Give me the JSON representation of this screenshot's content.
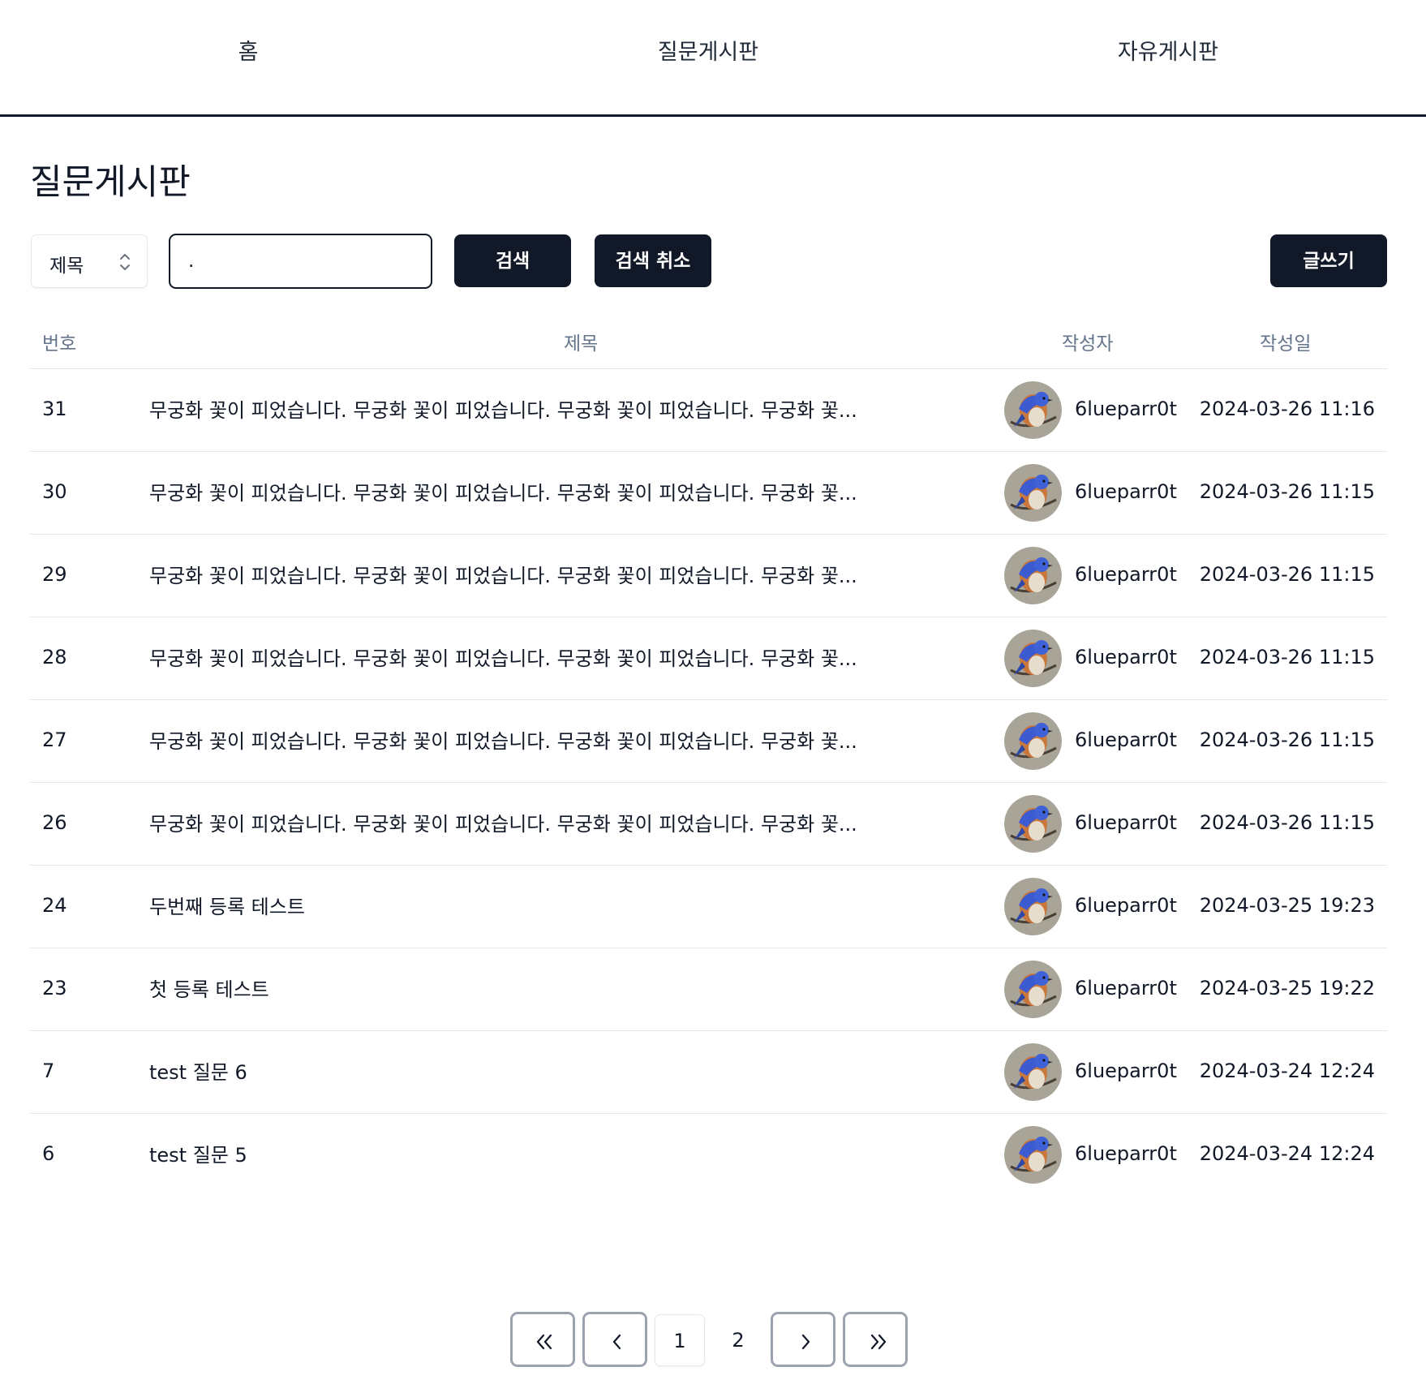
{
  "nav": {
    "home": "홈",
    "qna_board": "질문게시판",
    "free_board": "자유게시판"
  },
  "page": {
    "title": "질문게시판"
  },
  "toolbar": {
    "search_type_selected": "제목",
    "search_value": ".",
    "search_label": "검색",
    "cancel_label": "검색 취소",
    "write_label": "글쓰기"
  },
  "table": {
    "headers": {
      "number": "번호",
      "title": "제목",
      "author": "작성자",
      "date": "작성일"
    },
    "rows": [
      {
        "number": "31",
        "title": "무궁화 꽃이 피었습니다. 무궁화 꽃이 피었습니다. 무궁화 꽃이 피었습니다. 무궁화 꽃...",
        "author": "6lueparr0t",
        "date": "2024-03-26 11:16"
      },
      {
        "number": "30",
        "title": "무궁화 꽃이 피었습니다. 무궁화 꽃이 피었습니다. 무궁화 꽃이 피었습니다. 무궁화 꽃...",
        "author": "6lueparr0t",
        "date": "2024-03-26 11:15"
      },
      {
        "number": "29",
        "title": "무궁화 꽃이 피었습니다. 무궁화 꽃이 피었습니다. 무궁화 꽃이 피었습니다. 무궁화 꽃...",
        "author": "6lueparr0t",
        "date": "2024-03-26 11:15"
      },
      {
        "number": "28",
        "title": "무궁화 꽃이 피었습니다. 무궁화 꽃이 피었습니다. 무궁화 꽃이 피었습니다. 무궁화 꽃...",
        "author": "6lueparr0t",
        "date": "2024-03-26 11:15"
      },
      {
        "number": "27",
        "title": "무궁화 꽃이 피었습니다. 무궁화 꽃이 피었습니다. 무궁화 꽃이 피었습니다. 무궁화 꽃...",
        "author": "6lueparr0t",
        "date": "2024-03-26 11:15"
      },
      {
        "number": "26",
        "title": "무궁화 꽃이 피었습니다. 무궁화 꽃이 피었습니다. 무궁화 꽃이 피었습니다. 무궁화 꽃...",
        "author": "6lueparr0t",
        "date": "2024-03-26 11:15"
      },
      {
        "number": "24",
        "title": "두번째 등록 테스트",
        "author": "6lueparr0t",
        "date": "2024-03-25 19:23"
      },
      {
        "number": "23",
        "title": "첫 등록 테스트",
        "author": "6lueparr0t",
        "date": "2024-03-25 19:22"
      },
      {
        "number": "7",
        "title": "test 질문 6",
        "author": "6lueparr0t",
        "date": "2024-03-24 12:24"
      },
      {
        "number": "6",
        "title": "test 질문 5",
        "author": "6lueparr0t",
        "date": "2024-03-24 12:24"
      }
    ]
  },
  "pagination": {
    "pages": [
      "1",
      "2"
    ],
    "current": "1",
    "icons": [
      "double-chevron-left-icon",
      "chevron-left-icon",
      "chevron-right-icon",
      "double-chevron-right-icon"
    ]
  },
  "colors": {
    "primary_dark": "#111827",
    "header_text": "#64748b",
    "border": "#e5e7eb"
  }
}
